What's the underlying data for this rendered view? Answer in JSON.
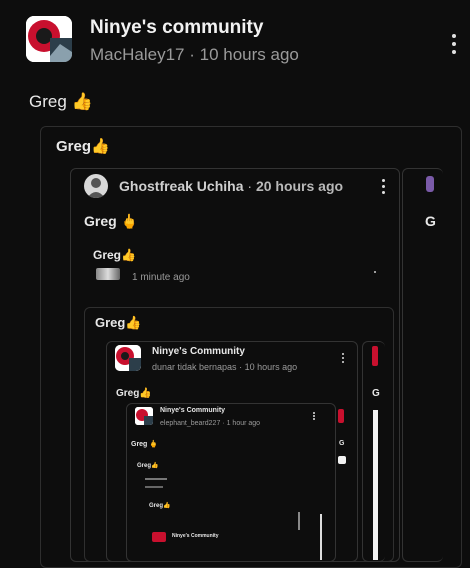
{
  "post": {
    "community": "Ninye's community",
    "author": "MacHaley17",
    "time": "10 hours ago",
    "body": "Greg 👍"
  },
  "level1": {
    "text": "Greg👍",
    "comment": {
      "author": "Ghostfreak Uchiha",
      "time": "20 hours ago",
      "body": "Greg 🖕",
      "side_char": "G"
    }
  },
  "level2": {
    "text": "Greg👍",
    "reply_time": "1 minute ago",
    "nested_text": "Greg👍"
  },
  "level3": {
    "community": "Ninye's Community",
    "author": "dunar tidak bernapas",
    "time": "10 hours ago",
    "body": "Greg👍",
    "side_char": "G"
  },
  "level4": {
    "community": "Ninye's Community",
    "author": "elephant_beard227",
    "time": "1 hour ago",
    "body": "Greg 🖕",
    "side_char": "G",
    "tiny1": "Greg👍",
    "tiny2": "Greg👍",
    "tiny3": "Ninye's Community"
  },
  "icons": {
    "dots": "⋮",
    "sep": "·"
  }
}
